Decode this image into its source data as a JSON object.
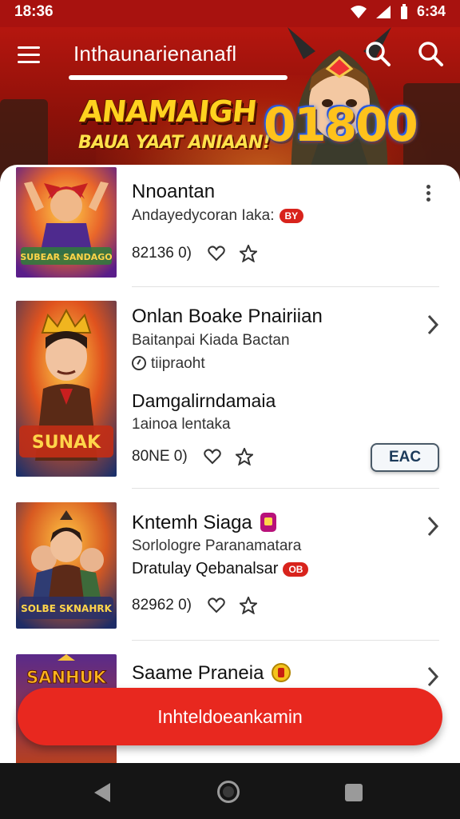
{
  "status_bar": {
    "time": "18:36",
    "right_time": "6:34"
  },
  "header": {
    "app_title": "Inthaunarienanafl"
  },
  "banner": {
    "headline": "ANAMAIGH",
    "subline": "BAUA YAAT ANIAAN!",
    "score": "01800"
  },
  "games": [
    {
      "title": "Nnoantan",
      "subtitle": "Andayedycoran Iaka:",
      "badge": "BY",
      "meta": "82136 0)",
      "art": "SUBEAR SANDAGO"
    },
    {
      "title": "Onlan Boake Pnairiian",
      "subtitle": "Baitanpai Kiada Bactan",
      "timer_text": "tiipraoht",
      "section_title": "Damgalirndamaia",
      "section_sub": "1ainoa lentaka",
      "meta": "80NE 0)",
      "button": "EAC",
      "art": "SUNAK"
    },
    {
      "title": "Kntemh Siaga",
      "subtitle": "Sorlologre Paranamatara",
      "subtitle2": "Dratulay Qebanalsar",
      "badge": "OB",
      "meta": "82962 0)",
      "art": "SOLBE SKNAHRK"
    },
    {
      "title": "Saame Praneia",
      "art": "SANHUK"
    }
  ],
  "fab": {
    "label": "Inhteldoeankamin"
  },
  "colors": {
    "brand_red": "#e8281f",
    "header_red": "#a8120f",
    "badge_red": "#d8231c"
  }
}
